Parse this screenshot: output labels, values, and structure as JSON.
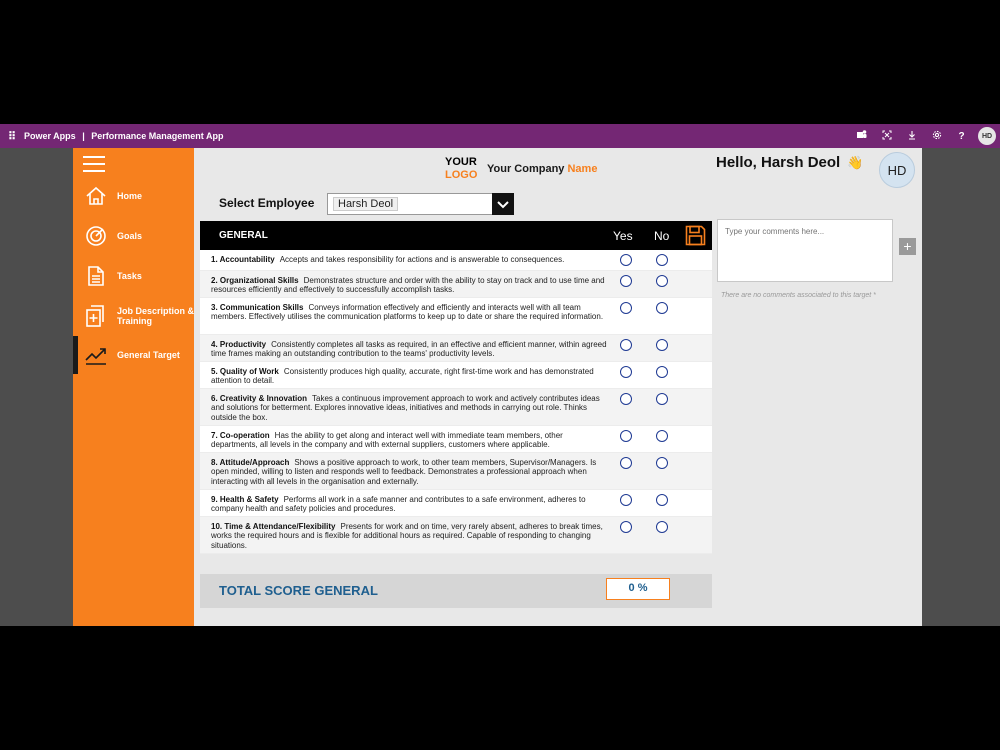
{
  "powerapps_bar": {
    "brand": "Power Apps",
    "separator": "|",
    "app_name": "Performance Management App",
    "avatar_initials": "HD",
    "icons": [
      "teams-icon",
      "fit-screen-icon",
      "download-icon",
      "settings-icon",
      "help-icon"
    ]
  },
  "sidebar": {
    "items": [
      {
        "label": "Home",
        "icon": "home-icon"
      },
      {
        "label": "Goals",
        "icon": "target-icon"
      },
      {
        "label": "Tasks",
        "icon": "document-icon"
      },
      {
        "label": "Job Description & Training",
        "icon": "add-pages-icon"
      },
      {
        "label": "General Target",
        "icon": "trend-chart-icon",
        "active": true
      }
    ]
  },
  "header": {
    "logo_line1": "YOUR",
    "logo_line2": "LOGO",
    "company_prefix": "Your Company ",
    "company_suffix": "Name",
    "greeting": "Hello, Harsh Deol",
    "greeting_emoji": "👋",
    "avatar_initials": "HD"
  },
  "employee_select": {
    "label": "Select Employee",
    "value": "Harsh Deol"
  },
  "general": {
    "title": "GENERAL",
    "yes_label": "Yes",
    "no_label": "No",
    "criteria": [
      {
        "title": "1.  Accountability",
        "desc": "Accepts and takes responsibility for actions and is answerable to consequences."
      },
      {
        "title": "2.  Organizational Skills",
        "desc": "Demonstrates structure and order with the ability to stay on track and to use time and resources efficiently and effectively to successfully accomplish tasks."
      },
      {
        "title": "3.  Communication Skills",
        "desc": "Conveys information effectively and efficiently and interacts well with all team members. Effectively utilises the communication platforms to keep up to date or share the required information."
      },
      {
        "title": "4.  Productivity",
        "desc": "Consistently completes all tasks as required, in an effective and efficient manner, within agreed time frames making an outstanding contribution to the teams' productivity levels."
      },
      {
        "title": "5.  Quality of Work",
        "desc": "Consistently produces high quality, accurate, right first-time work and has demonstrated attention to detail."
      },
      {
        "title": "6.  Creativity & Innovation",
        "desc": "Takes a continuous improvement approach to work and actively contributes ideas and solutions for betterment. Explores innovative ideas, initiatives and methods in carrying out role. Thinks outside the box."
      },
      {
        "title": "7.  Co-operation",
        "desc": "Has the ability to get along and interact well with immediate team members, other departments, all levels in the company and with external suppliers, customers where applicable."
      },
      {
        "title": "8.  Attitude/Approach",
        "desc": "Shows a positive approach to work, to other team members, Supervisor/Managers. Is open minded, willing to listen and responds well to feedback. Demonstrates a professional approach when interacting with all levels in the organisation and externally."
      },
      {
        "title": "9.  Health & Safety",
        "desc": "Performs all work in a safe manner and contributes to a safe environment, adheres to company health and safety policies and procedures."
      },
      {
        "title": "10.  Time & Attendance/Flexibility",
        "desc": "Presents for work and on time, very rarely absent, adheres to break times, works the required hours and is flexible for additional hours as required. Capable of responding to changing situations."
      }
    ]
  },
  "total": {
    "label": "TOTAL SCORE GENERAL",
    "value": "0 %"
  },
  "comments": {
    "placeholder": "Type your comments here...",
    "empty_message": "There are no comments associated to this target *"
  },
  "colors": {
    "powerapps_purple": "#742774",
    "brand_orange": "#f7801e",
    "total_blue": "#1f5f8f",
    "radio_blue": "#1f3a93"
  }
}
